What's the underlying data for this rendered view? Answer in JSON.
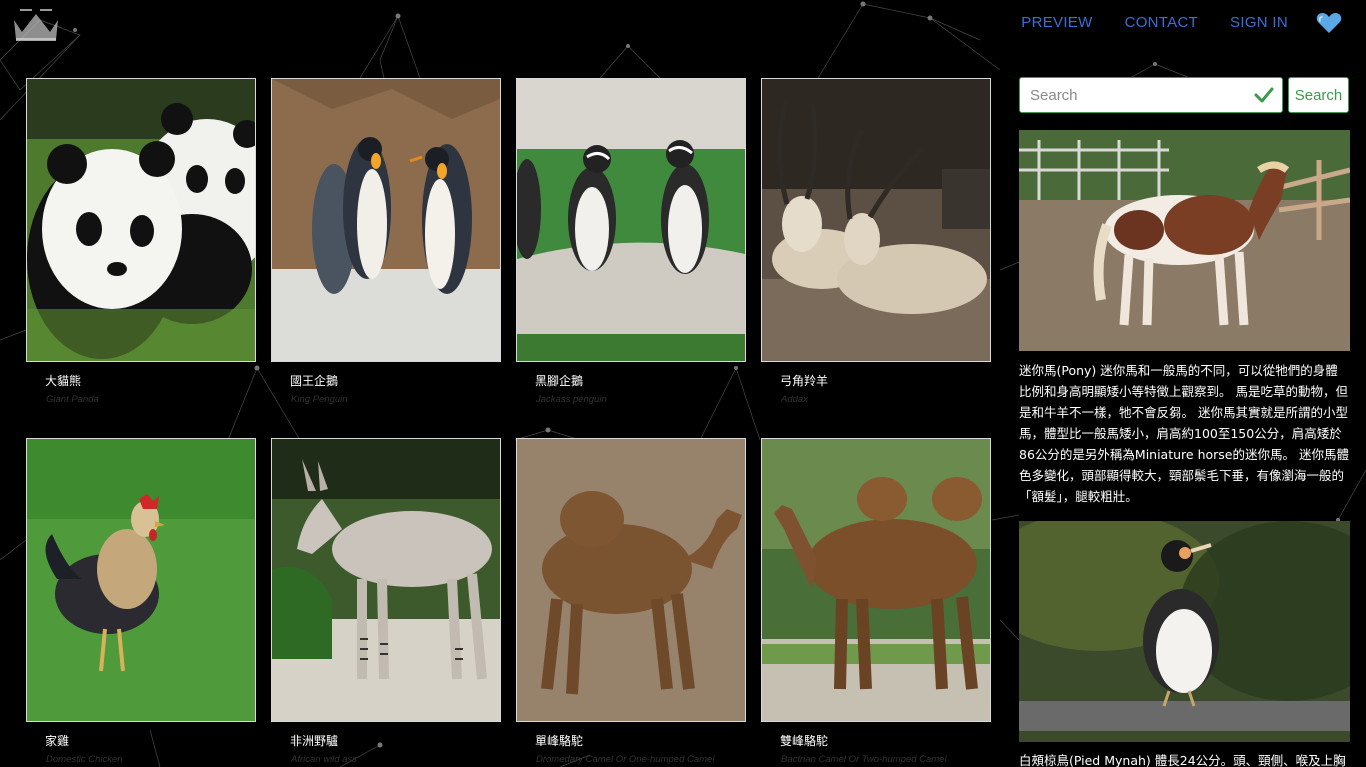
{
  "nav": {
    "preview": "PREVIEW",
    "contact": "CONTACT",
    "sign_in": "SIGN IN",
    "heart_icon": "heart-icon",
    "link_color": "#3a6fd8"
  },
  "logo": {
    "icon": "crown-logo-icon"
  },
  "animals": [
    {
      "zh": "大貓熊",
      "en": "Giant Panda"
    },
    {
      "zh": "國王企鵝",
      "en": "King Penguin"
    },
    {
      "zh": "黑腳企鵝",
      "en": "Jackass penguin"
    },
    {
      "zh": "弓角羚羊",
      "en": "Addax"
    },
    {
      "zh": "家雞",
      "en": "Domestic Chicken"
    },
    {
      "zh": "非洲野驢",
      "en": "African wild ass"
    },
    {
      "zh": "單峰駱駝",
      "en": "Dromedary Camel Or One-humped Camel"
    },
    {
      "zh": "雙峰駱駝",
      "en": "Bactrian Camel Or Two-humped Camel"
    }
  ],
  "search": {
    "placeholder": "Search",
    "button_label": "Search",
    "accent": "#3c9a4a"
  },
  "sidebar": {
    "feature_1_text": "迷你馬(Pony) 迷你馬和一般馬的不同，可以從牠們的身體比例和身高明顯矮小等特徵上觀察到。 馬是吃草的動物，但是和牛羊不一樣，牠不會反芻。 迷你馬其實就是所謂的小型馬，體型比一般馬矮小，肩高約100至150公分，肩高矮於86公分的是另外稱為Miniature horse的迷你馬。 迷你馬體色多變化，頭部顯得較大，頸部鬃毛下垂，有像瀏海一般的「額髮」，腿較粗壯。",
    "feature_2_text": "白頰椋鳥(Pied Mynah) 體長24公分。頭、頸側、喉及上胸"
  }
}
